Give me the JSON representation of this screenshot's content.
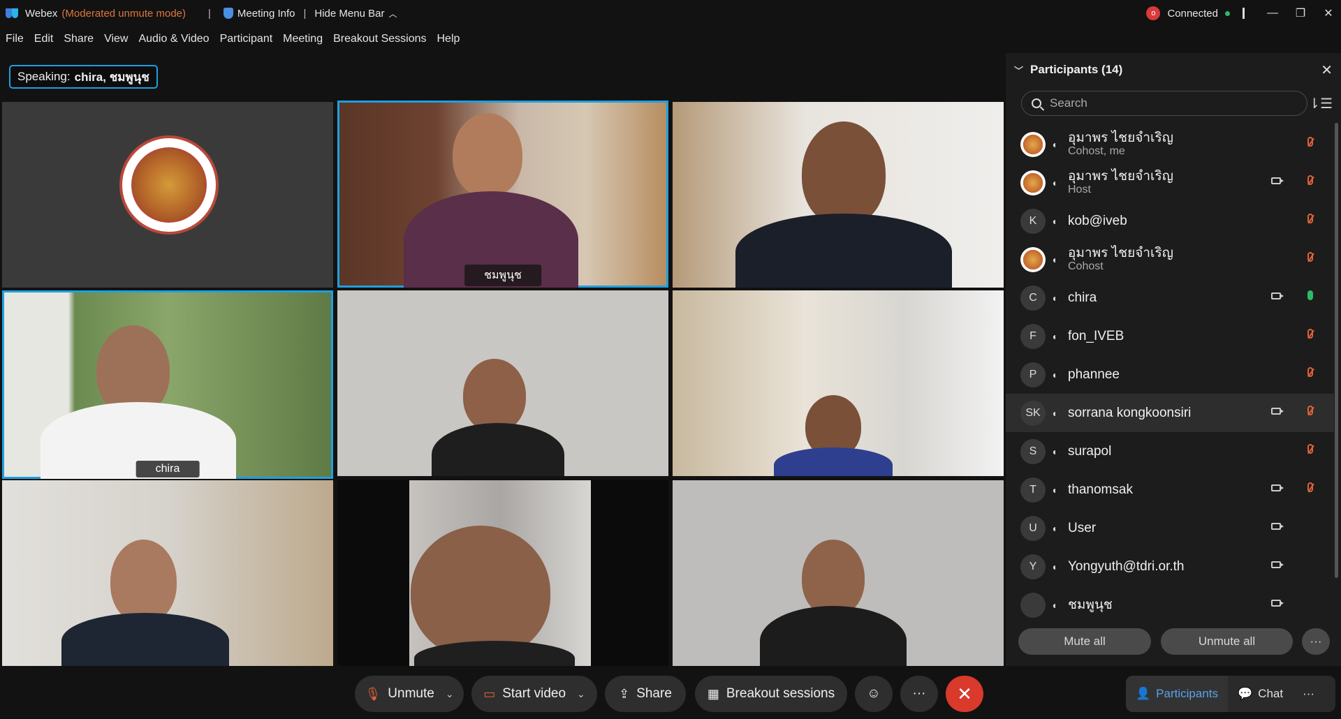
{
  "titlebar": {
    "app": "Webex",
    "mode": "(Moderated unmute mode)",
    "meeting_info": "Meeting Info",
    "hide_menu": "Hide Menu Bar",
    "status": "Connected",
    "rec_letter": "o"
  },
  "menu": [
    "File",
    "Edit",
    "Share",
    "View",
    "Audio & Video",
    "Participant",
    "Meeting",
    "Breakout Sessions",
    "Help"
  ],
  "speaking": {
    "label": "Speaking:",
    "names": "chira, ชมพูนุช"
  },
  "tiles": [
    {
      "name": "",
      "active": false
    },
    {
      "name": "ชมพูนุช",
      "active": true
    },
    {
      "name": "",
      "active": false
    },
    {
      "name": "chira",
      "active": true
    },
    {
      "name": "",
      "active": false
    },
    {
      "name": "",
      "active": false
    },
    {
      "name": "",
      "active": false
    },
    {
      "name": "",
      "active": false
    },
    {
      "name": "",
      "active": false
    }
  ],
  "panel": {
    "title": "Participants (14)",
    "search_placeholder": "Search",
    "participants": [
      {
        "initials": "",
        "name": "อุมาพร ไชยจำเริญ",
        "role": "Cohost, me",
        "cam": false,
        "mic": "off",
        "img": true
      },
      {
        "initials": "",
        "name": "อุมาพร ไชยจำเริญ",
        "role": "Host",
        "cam": true,
        "mic": "off",
        "img": true
      },
      {
        "initials": "K",
        "name": "kob@iveb",
        "role": "",
        "cam": false,
        "mic": "off",
        "img": false
      },
      {
        "initials": "",
        "name": "อุมาพร ไชยจำเริญ",
        "role": "Cohost",
        "cam": false,
        "mic": "off",
        "img": true
      },
      {
        "initials": "C",
        "name": "chira",
        "role": "",
        "cam": true,
        "mic": "on",
        "img": false
      },
      {
        "initials": "F",
        "name": "fon_IVEB",
        "role": "",
        "cam": false,
        "mic": "off",
        "img": false
      },
      {
        "initials": "P",
        "name": "phannee",
        "role": "",
        "cam": false,
        "mic": "off",
        "img": false
      },
      {
        "initials": "SK",
        "name": "sorrana kongkoonsiri",
        "role": "",
        "cam": true,
        "mic": "off",
        "img": false,
        "hl": true
      },
      {
        "initials": "S",
        "name": "surapol",
        "role": "",
        "cam": false,
        "mic": "off",
        "img": false
      },
      {
        "initials": "T",
        "name": "thanomsak",
        "role": "",
        "cam": true,
        "mic": "off",
        "img": false
      },
      {
        "initials": "U",
        "name": "User",
        "role": "",
        "cam": true,
        "mic": "none",
        "img": false
      },
      {
        "initials": "Y",
        "name": "Yongyuth@tdri.or.th",
        "role": "",
        "cam": true,
        "mic": "none",
        "img": false
      },
      {
        "initials": "",
        "name": "ชมพูนุช",
        "role": "",
        "cam": true,
        "mic": "none",
        "img": false
      }
    ],
    "mute_all": "Mute all",
    "unmute_all": "Unmute all",
    "more": "···"
  },
  "controls": {
    "unmute": "Unmute",
    "start_video": "Start video",
    "share": "Share",
    "breakout": "Breakout sessions",
    "more": "···",
    "end": "✕"
  },
  "tabs": {
    "participants": "Participants",
    "chat": "Chat",
    "more": "···"
  },
  "colors": {
    "accent": "#1ea0e0",
    "danger": "#d93a2b",
    "mode": "#e0763a",
    "mic_on": "#2fb866"
  }
}
